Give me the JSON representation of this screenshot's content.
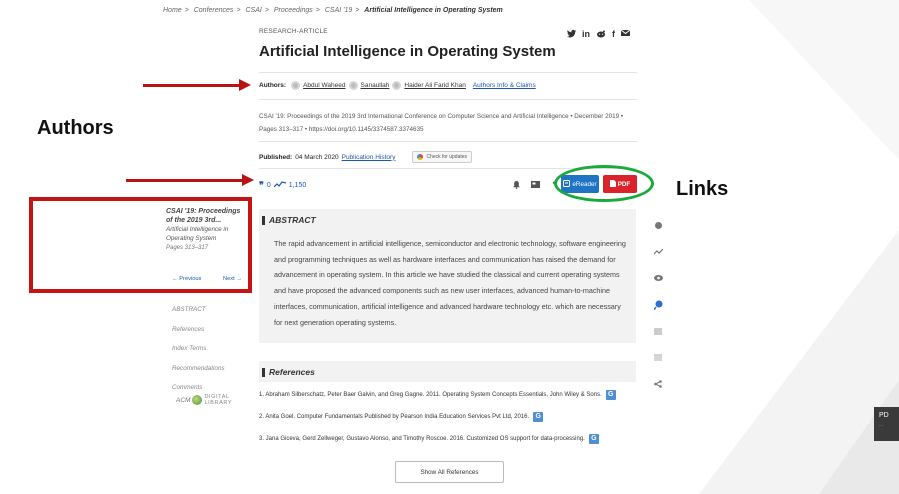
{
  "breadcrumb": [
    "Home",
    "Conferences",
    "CSAI",
    "Proceedings",
    "CSAI '19",
    "Artificial Intelligence in Operating System"
  ],
  "breadcrumb_separator": ">",
  "article": {
    "type_label": "RESEARCH-ARTICLE",
    "title": "Artificial Intelligence in Operating System",
    "social_icons": [
      "twitter-icon",
      "linkedin-icon",
      "reddit-icon",
      "facebook-icon",
      "email-icon"
    ],
    "authors_label": "Authors:",
    "authors": [
      "Abdul Waheed",
      "Sanaullah",
      "Haider Ali Farid Khan"
    ],
    "authors_info_link": "Authors Info & Claims",
    "citation_line1": "CSAI '19: Proceedings of the 2019 3rd International Conference on Computer Science and Artificial Intelligence • December 2019 •",
    "citation_line2": "Pages 313–317 • https://doi.org/10.1145/3374587.3374635",
    "published_label": "Published:",
    "published_date": "04 March 2020",
    "publication_history_link": "Publication History",
    "check_updates_label": "Check for updates",
    "citations_count": "0",
    "downloads_count": "1,150",
    "ereader_label": "eReader",
    "pdf_label": "PDF"
  },
  "annotations": {
    "authors_label": "Authors",
    "links_label": "Links"
  },
  "sidebar": {
    "proceeding_title": "CSAI '19: Proceedings of the 2019 3rd...",
    "article_title": "Artificial Intelligence in Operating System",
    "pages": "Pages 313–317",
    "previous_label": "← Previous",
    "next_label": "Next →",
    "menu": [
      "ABSTRACT",
      "References",
      "Index Terms",
      "Recommendations",
      "Comments"
    ],
    "logo_text": "ACM",
    "logo_sub1": "DIGITAL",
    "logo_sub2": "LIBRARY"
  },
  "abstract": {
    "heading": "ABSTRACT",
    "text": "The rapid advancement in artificial intelligence, semiconductor and electronic technology, software engineering and programming techniques as well as hardware interfaces and communication has raised the demand for advancement in operating system. In this article we have studied the classical and current operating systems and have proposed the advanced components such as new user interfaces, advanced human-to-machine interfaces, communication, artificial intelligence and advanced hardware technology etc. which are necessary for next generation operating systems."
  },
  "references": {
    "heading": "References",
    "items": [
      "1. Abraham Silberschatz, Peter Baer Galvin, and Greg Gagne. 2011. Operating System Concepts Essentials, John Wiley & Sons.",
      "2. Anita Goel. Computer Fundamentals Published by Pearson India Education Services Pvt Ltd, 2016.",
      "3. Jana Giceva, Gerd Zellweger, Gustavo Alonso, and Timothy Roscoe. 2016. Customized OS support for data-processing."
    ],
    "show_all_label": "Show All References"
  },
  "pdf_tab": {
    "label": "PD"
  },
  "colors": {
    "accent_blue": "#1f74c4",
    "pdf_red": "#d9242b",
    "annotation_red": "#b81414",
    "annotation_green": "#1aaa3a"
  }
}
